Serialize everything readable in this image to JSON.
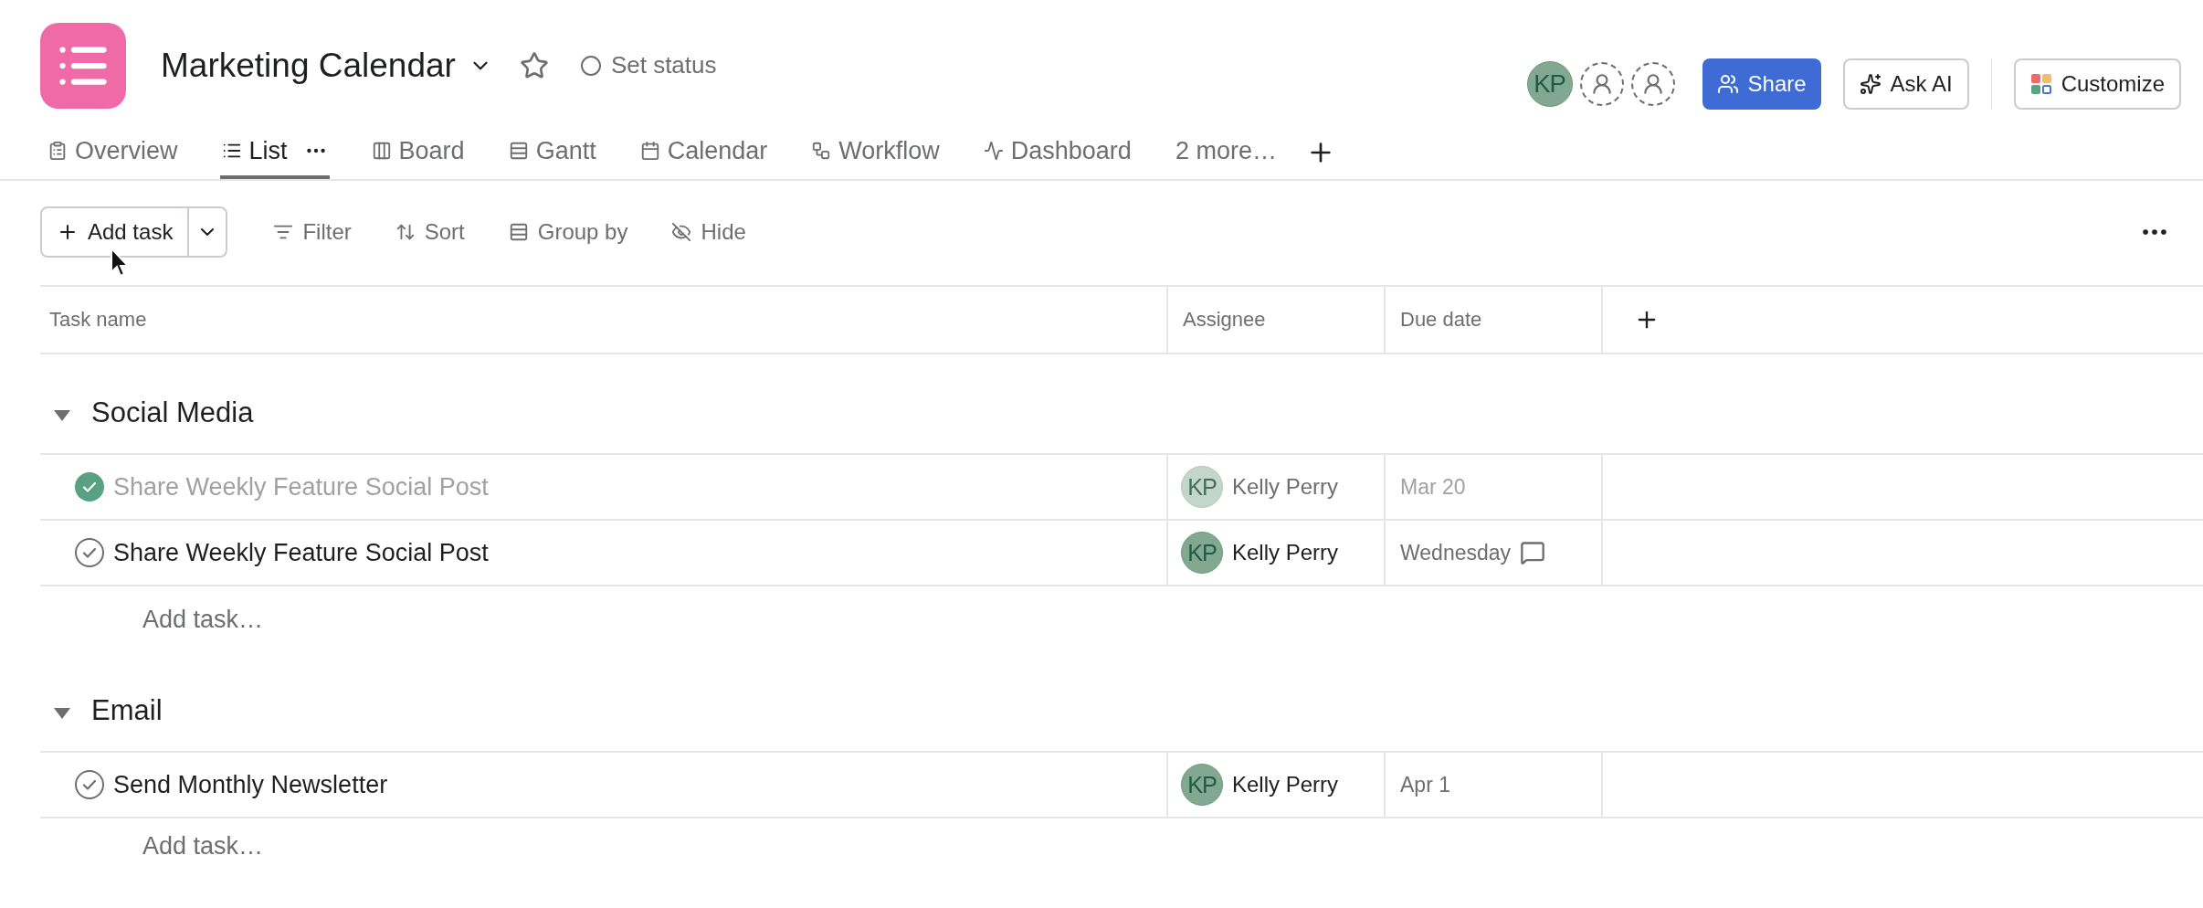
{
  "project": {
    "title": "Marketing Calendar",
    "status": "Set status"
  },
  "members": [
    {
      "kind": "user",
      "initials": "KP"
    },
    {
      "kind": "empty"
    },
    {
      "kind": "empty"
    }
  ],
  "actions": [
    {
      "kind": "primary",
      "label": "Share"
    },
    {
      "kind": "ai",
      "label": "Ask AI"
    },
    {
      "kind": "customize",
      "label": "Customize"
    }
  ],
  "tabs": [
    {
      "kind": "overview",
      "label": "Overview",
      "selected": false
    },
    {
      "kind": "list",
      "label": "List",
      "selected": true
    },
    {
      "kind": "board",
      "label": "Board",
      "selected": false
    },
    {
      "kind": "gantt",
      "label": "Gantt",
      "selected": false
    },
    {
      "kind": "calendar",
      "label": "Calendar",
      "selected": false
    },
    {
      "kind": "workflow",
      "label": "Workflow",
      "selected": false
    },
    {
      "kind": "dashboard",
      "label": "Dashboard",
      "selected": false
    },
    {
      "kind": "more",
      "label": "2 more…",
      "selected": false
    }
  ],
  "toolbar": {
    "add_task": "Add task",
    "tools": [
      {
        "kind": "filter",
        "label": "Filter"
      },
      {
        "kind": "sort",
        "label": "Sort"
      },
      {
        "kind": "group",
        "label": "Group by"
      },
      {
        "kind": "hide",
        "label": "Hide"
      }
    ]
  },
  "columns": [
    "Task name",
    "Assignee",
    "Due date"
  ],
  "sections": [
    {
      "name": "Social Media",
      "add_label": "Add task…",
      "tasks": [
        {
          "name": "Share Weekly Feature Social Post",
          "completed": true,
          "assignee": {
            "initials": "KP",
            "name": "Kelly Perry"
          },
          "due": "Mar 20",
          "comment": false
        },
        {
          "name": "Share Weekly Feature Social Post",
          "completed": false,
          "assignee": {
            "initials": "KP",
            "name": "Kelly Perry"
          },
          "due": "Wednesday",
          "comment": true
        }
      ]
    },
    {
      "name": "Email",
      "add_label": "Add task…",
      "tasks": [
        {
          "name": "Send Monthly Newsletter",
          "completed": false,
          "assignee": {
            "initials": "KP",
            "name": "Kelly Perry"
          },
          "due": "Apr 1",
          "comment": false
        }
      ]
    }
  ]
}
